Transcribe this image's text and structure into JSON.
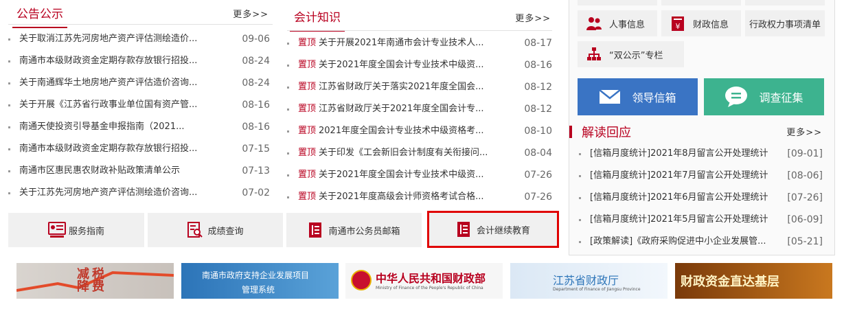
{
  "notice": {
    "title": "公告公示",
    "more": "更多>>",
    "items": [
      {
        "title": "关于取消江苏先河房地产资产评估测绘造价...",
        "date": "09-06"
      },
      {
        "title": "南通市本级财政资金定期存款存放银行招投...",
        "date": "08-24"
      },
      {
        "title": "关于南通辉华土地房地产资产评估造价咨询...",
        "date": "08-24"
      },
      {
        "title": "关于开展《江苏省行政事业单位国有资产管...",
        "date": "08-16"
      },
      {
        "title": "南通天使投资引导基金申报指南（2021...",
        "date": "08-16"
      },
      {
        "title": "南通市本级财政资金定期存款存放银行招投...",
        "date": "07-15"
      },
      {
        "title": "南通市区惠民惠农财政补贴政策清单公示",
        "date": "07-13"
      },
      {
        "title": "关于江苏先河房地产资产评估测绘造价咨询...",
        "date": "07-02"
      }
    ]
  },
  "accounting": {
    "title": "会计知识",
    "more": "更多>>",
    "top_tag": "置顶",
    "items": [
      {
        "title": "关于开展2021年南通市会计专业技术人...",
        "date": "08-17"
      },
      {
        "title": "关于2021年度全国会计专业技术中级资...",
        "date": "08-16"
      },
      {
        "title": "江苏省财政厅关于落实2021年度全国会...",
        "date": "08-12"
      },
      {
        "title": "江苏省财政厅关于2021年度全国会计专...",
        "date": "08-12"
      },
      {
        "title": "2021年度全国会计专业技术中级资格考...",
        "date": "08-10"
      },
      {
        "title": "关于印发《工会新旧会计制度有关衔接问...",
        "date": "08-04"
      },
      {
        "title": "关于2021年度全国会计专业技术中级资...",
        "date": "07-26"
      },
      {
        "title": "关于2021年度高级会计师资格考试合格...",
        "date": "07-26"
      }
    ]
  },
  "services": [
    {
      "label": "服务指南"
    },
    {
      "label": "成绩查询"
    },
    {
      "label": "南通市公务员邮箱"
    },
    {
      "label": "会计继续教育"
    }
  ],
  "quick_links": {
    "personnel": "人事信息",
    "finance": "财政信息",
    "power_list": "行政权力事项清单",
    "double": "“双公示”专栏"
  },
  "big_buttons": {
    "mailbox": "领导信箱",
    "survey": "调查征集",
    "mailbox_color": "#3a74c4",
    "survey_color": "#3db38f"
  },
  "interpret": {
    "title": "解读回应",
    "more": "更多>>",
    "items": [
      {
        "title": "[信箱月度统计]2021年8月留言公开处理统计",
        "date": "[09-01]"
      },
      {
        "title": "[信箱月度统计]2021年7月留言公开处理统计",
        "date": "[08-06]"
      },
      {
        "title": "[信箱月度统计]2021年6月留言公开处理统计",
        "date": "[07-26]"
      },
      {
        "title": "[信箱月度统计]2021年5月留言公开处理统计",
        "date": "[06-09]"
      },
      {
        "title": "[政策解读]《政府采购促进中小企业发展管...",
        "date": "[05-21]"
      }
    ]
  },
  "banners": {
    "tax": "减税降费",
    "project_line1": "南通市政府支持企业发展项目",
    "project_line2": "管理系统",
    "mof_cn": "中华人民共和国财政部",
    "mof_en": "Ministry of Finance of the People's Republic of China",
    "jiangsu": "江苏省财政厅",
    "jiangsu_en": "Department of Finance of Jiangsu Province",
    "direct": "财政资金直达基层"
  },
  "colors": {
    "brand_red": "#b8001f",
    "highlight_red": "#e00000"
  }
}
